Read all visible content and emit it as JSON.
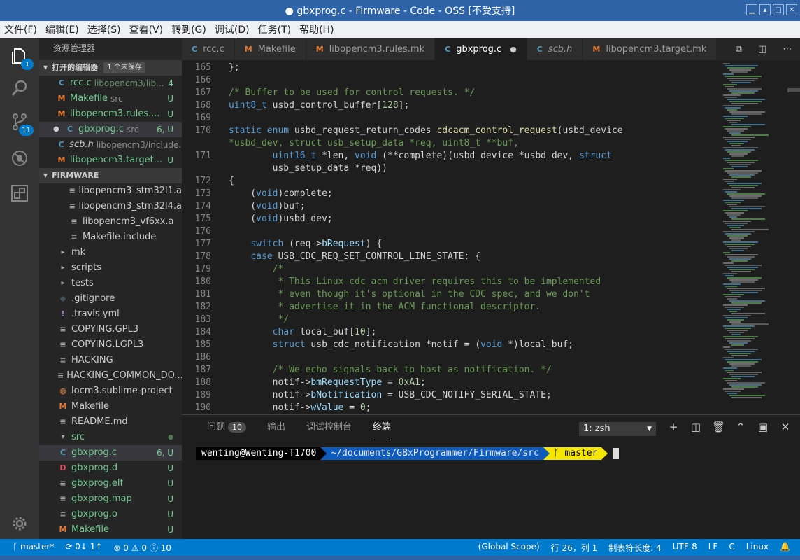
{
  "window": {
    "title": "● gbxprog.c - Firmware - Code - OSS [不受支持]"
  },
  "menu": [
    "文件(F)",
    "编辑(E)",
    "选择(S)",
    "查看(V)",
    "转到(G)",
    "调试(D)",
    "任务(T)",
    "帮助(H)"
  ],
  "activity": {
    "explorer_badge": "1",
    "scm_badge": "11"
  },
  "sidebar": {
    "title": "资源管理器",
    "open_editors": {
      "label": "打开的编辑器",
      "unsaved": "1 个未保存",
      "items": [
        {
          "icon": "C",
          "name": "rcc.c",
          "desc": "libopencm3/lib...",
          "status": "4"
        },
        {
          "icon": "M",
          "name": "Makefile",
          "desc": "src",
          "status": "U"
        },
        {
          "icon": "M",
          "name": "libopencm3.rules....",
          "desc": "",
          "status": "U"
        },
        {
          "icon": "C",
          "name": "gbxprog.c",
          "desc": "src",
          "status": "6, U"
        },
        {
          "icon": "C",
          "name": "scb.h",
          "desc": "libopencm3/include...",
          "status": ""
        },
        {
          "icon": "M",
          "name": "libopencm3.target...",
          "desc": "",
          "status": "U"
        }
      ]
    },
    "folder": {
      "label": "FIRMWARE",
      "items": [
        {
          "icon": "≡",
          "name": "libopencm3_stm32l1.a",
          "status": ""
        },
        {
          "icon": "≡",
          "name": "libopencm3_stm32l4.a",
          "status": ""
        },
        {
          "icon": "≡",
          "name": "libopencm3_vf6xx.a",
          "status": ""
        },
        {
          "icon": "≡",
          "name": "Makefile.include",
          "status": ""
        },
        {
          "icon": "▸",
          "name": "mk",
          "status": ""
        },
        {
          "icon": "▸",
          "name": "scripts",
          "status": ""
        },
        {
          "icon": "▸",
          "name": "tests",
          "status": ""
        },
        {
          "icon": "◆",
          "name": ".gitignore",
          "status": ""
        },
        {
          "icon": "!",
          "name": ".travis.yml",
          "status": ""
        },
        {
          "icon": "≡",
          "name": "COPYING.GPL3",
          "status": ""
        },
        {
          "icon": "≡",
          "name": "COPYING.LGPL3",
          "status": ""
        },
        {
          "icon": "≡",
          "name": "HACKING",
          "status": ""
        },
        {
          "icon": "≡",
          "name": "HACKING_COMMON_DO...",
          "status": ""
        },
        {
          "icon": "◍",
          "name": "locm3.sublime-project",
          "status": ""
        },
        {
          "icon": "M",
          "name": "Makefile",
          "status": ""
        },
        {
          "icon": "≡",
          "name": "README.md",
          "status": ""
        },
        {
          "icon": "▾",
          "name": "src",
          "status": "●"
        },
        {
          "icon": "C",
          "name": "gbxprog.c",
          "status": "6, U"
        },
        {
          "icon": "D",
          "name": "gbxprog.d",
          "status": "U"
        },
        {
          "icon": "≡",
          "name": "gbxprog.elf",
          "status": "U"
        },
        {
          "icon": "≡",
          "name": "gbxprog.map",
          "status": "U"
        },
        {
          "icon": "≡",
          "name": "gbxprog.o",
          "status": "U"
        },
        {
          "icon": "M",
          "name": "Makefile",
          "status": "U"
        }
      ]
    }
  },
  "tabs": [
    {
      "icon": "C",
      "label": "rcc.c"
    },
    {
      "icon": "M",
      "label": "Makefile"
    },
    {
      "icon": "M",
      "label": "libopencm3.rules.mk"
    },
    {
      "icon": "C",
      "label": "gbxprog.c",
      "dirty": "●"
    },
    {
      "icon": "C",
      "label": "scb.h"
    },
    {
      "icon": "M",
      "label": "libopencm3.target.mk"
    }
  ],
  "editor": {
    "line_numbers": [
      "165",
      "166",
      "167",
      "168",
      "169",
      "170",
      "",
      "171",
      "",
      "172",
      "173",
      "174",
      "175",
      "176",
      "177",
      "178",
      "179",
      "180",
      "181",
      "182",
      "183",
      "184",
      "185",
      "186",
      "187",
      "188",
      "189",
      "190"
    ],
    "lines": [
      "};",
      "",
      "/* Buffer to be used for control requests. */",
      "uint8_t usbd_control_buffer[128];",
      "",
      "static enum usbd_request_return_codes cdcacm_control_request(usbd_device",
      "*usbd_dev, struct usb_setup_data *req, uint8_t **buf,",
      "        uint16_t *len, void (**complete)(usbd_device *usbd_dev, struct",
      "        usb_setup_data *req))",
      "{",
      "    (void)complete;",
      "    (void)buf;",
      "    (void)usbd_dev;",
      "",
      "    switch (req->bRequest) {",
      "    case USB_CDC_REQ_SET_CONTROL_LINE_STATE: {",
      "        /*",
      "         * This Linux cdc_acm driver requires this to be implemented",
      "         * even though it's optional in the CDC spec, and we don't",
      "         * advertise it in the ACM functional descriptor.",
      "         */",
      "        char local_buf[10];",
      "        struct usb_cdc_notification *notif = (void *)local_buf;",
      "",
      "        /* We echo signals back to host as notification. */",
      "        notif->bmRequestType = 0xA1;",
      "        notif->bNotification = USB_CDC_NOTIFY_SERIAL_STATE;",
      "        notif->wValue = 0;"
    ]
  },
  "panel": {
    "tabs": [
      "问题",
      "输出",
      "调试控制台",
      "终端"
    ],
    "problems_count": "10",
    "shell": "1: zsh",
    "prompt": {
      "user": "wenting@Wenting-T1700",
      "dir": "~/documents/GBxProgrammer/Firmware/src",
      "branch": "ᚴ master"
    }
  },
  "status": {
    "branch": "master*",
    "sync": "0↓ 1↑",
    "errors": "0",
    "warnings": "0",
    "info": "10",
    "scope": "(Global Scope)",
    "position": "行 26，列 1",
    "tabsize": "制表符长度: 4",
    "encoding": "UTF-8",
    "eol": "LF",
    "language": "C",
    "os": "Linux"
  },
  "colors": {
    "accent": "#007acc",
    "titlebar": "#2e63a8",
    "sidebar": "#252526",
    "editor": "#1e1e1e"
  }
}
